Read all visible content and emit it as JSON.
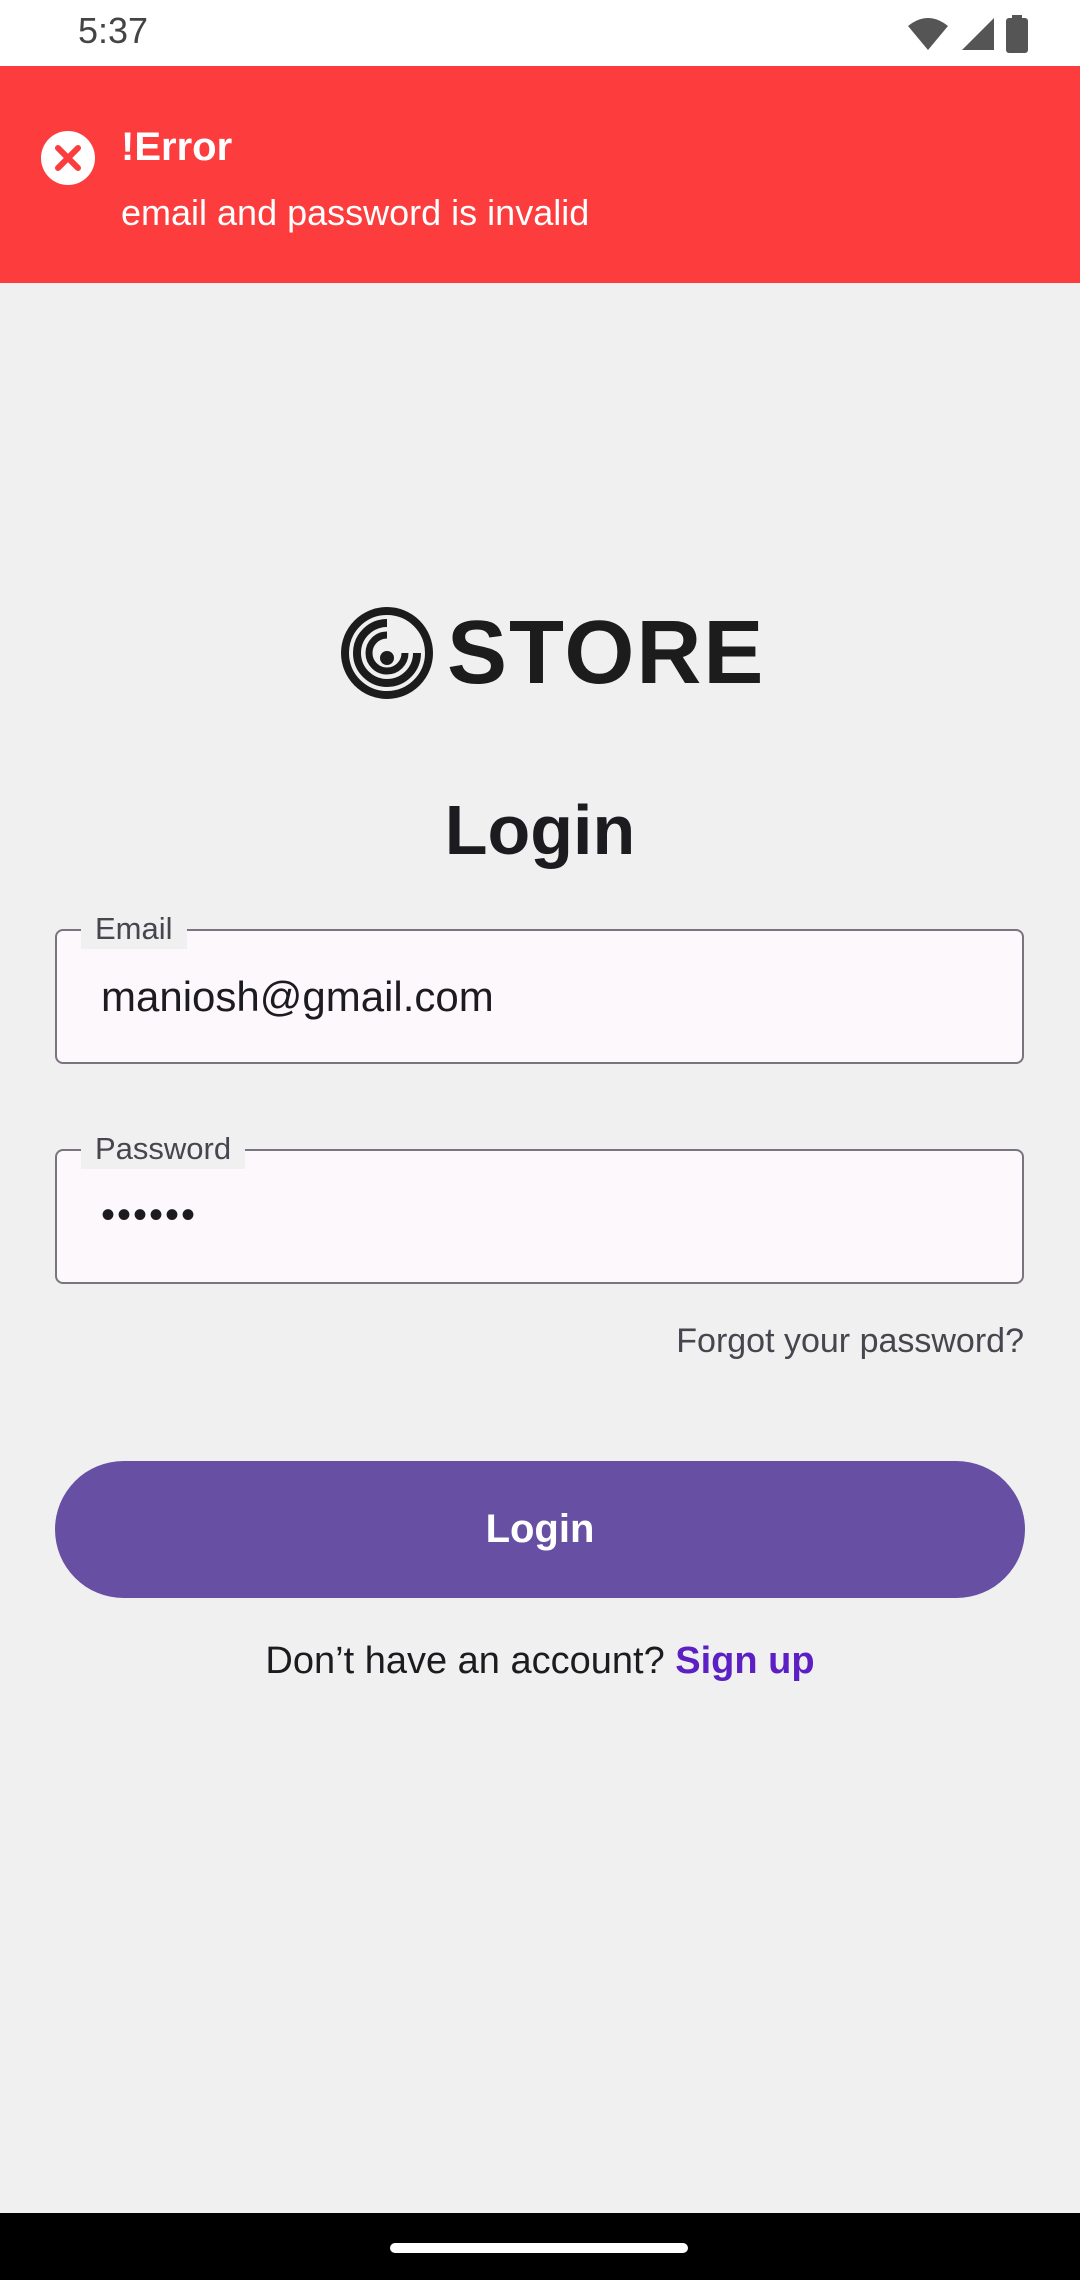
{
  "status_bar": {
    "time": "5:37",
    "icons": [
      "wifi-icon",
      "signal-icon",
      "battery-icon"
    ]
  },
  "error_banner": {
    "icon": "close-circle-icon",
    "title": "!Error",
    "message": "email and password is invalid",
    "color": "#fc3c3d"
  },
  "logo": {
    "icon": "swirl-logo-icon",
    "text": "STORE"
  },
  "page_title": "Login",
  "email_field": {
    "label": "Email",
    "value": "maniosh@gmail.com"
  },
  "password_field": {
    "label": "Password",
    "value": "••••••"
  },
  "forgot_password": "Forgot your password?",
  "login_button": {
    "label": "Login",
    "color": "#6750a4"
  },
  "signup": {
    "prompt": "Don’t have an account?",
    "link": "Sign up",
    "link_color": "#5b1fc4"
  }
}
